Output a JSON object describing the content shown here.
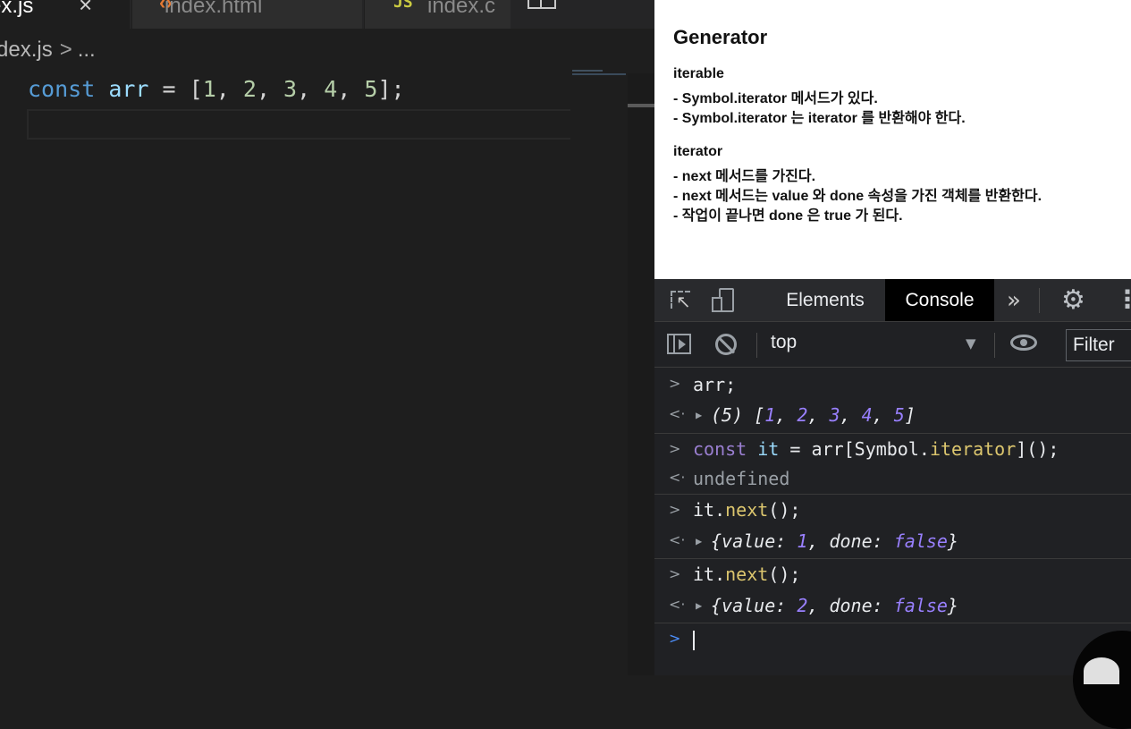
{
  "editor": {
    "tabs": [
      {
        "label": "ex.js",
        "active": true
      },
      {
        "label": "index.html",
        "active": false
      },
      {
        "label": "index.c",
        "active": false
      }
    ],
    "tab_js_icon": "JS",
    "breadcrumb": {
      "file": "dex.js",
      "sep": ">",
      "rest": "..."
    },
    "code": {
      "kw": "const",
      "name": "arr",
      "eq": " = ",
      "open": "[",
      "n1": "1",
      "n2": "2",
      "n3": "3",
      "n4": "4",
      "n5": "5",
      "comma": ", ",
      "close": "];"
    }
  },
  "page": {
    "title": "Generator",
    "lines": [
      "iterable",
      "- Symbol.iterator 메서드가 있다.",
      "- Symbol.iterator 는 iterator 를 반환해야 한다.",
      "",
      "iterator",
      "- next 메서드를 가진다.",
      "- next 메서드는 value 와 done 속성을 가진 객체를 반환한다.",
      "- 작업이 끝나면 done 은 true 가 된다."
    ]
  },
  "devtools": {
    "tabs": {
      "elements": "Elements",
      "console": "Console"
    },
    "context": "top",
    "filter_placeholder": "Filter",
    "icons": [
      "inspect-icon",
      "device-icon",
      "more-tabs-icon",
      "gear-icon",
      "kebab-icon",
      "sidebar-toggle-icon",
      "clear-icon",
      "eye-icon"
    ]
  },
  "console": {
    "r1": "arr;",
    "r2": {
      "count": "(5) [",
      "n1": "1",
      "n2": "2",
      "n3": "3",
      "n4": "4",
      "n5": "5",
      "sep": ", ",
      "close": "]"
    },
    "r3": {
      "kw": "const",
      "sp": " ",
      "var": "it",
      "mid": " = arr[Symbol.",
      "fn": "iterator",
      "end": "]();"
    },
    "r4": "undefined",
    "r5": {
      "obj": "it.",
      "fn": "next",
      "end": "();"
    },
    "r6": {
      "open": "{value: ",
      "num": "1",
      "mid": ", done: ",
      "bool": "false",
      "close": "}"
    },
    "r7": {
      "obj": "it.",
      "fn": "next",
      "end": "();"
    },
    "r8": {
      "open": "{value: ",
      "num": "2",
      "mid": ", done: ",
      "bool": "false",
      "close": "}"
    },
    "prompt_arrow": ">",
    "result_arrow": "<·"
  }
}
